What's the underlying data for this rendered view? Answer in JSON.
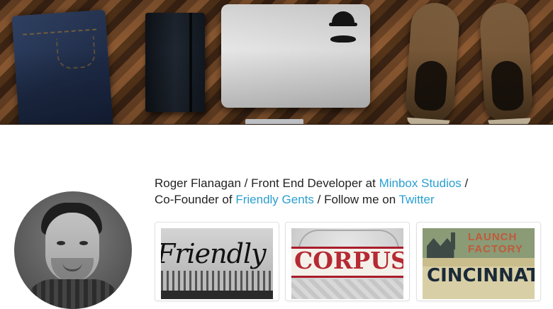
{
  "bio": {
    "name": "Roger Flanagan",
    "sep1": " / ",
    "role": "Front End Developer at ",
    "company_link": "Minbox Studios",
    "sep2": " /",
    "cofounder": "Co-Founder of ",
    "gents_link": "Friendly Gents",
    "sep3": " / ",
    "follow": "Follow me on ",
    "twitter_link": "Twitter"
  },
  "portfolio": [
    {
      "text": "Friendly Ge"
    },
    {
      "text": "CORPUS"
    },
    {
      "text_top": "LAUNCH\nFACTORY",
      "text_bottom": "CINCINNATI'S"
    }
  ],
  "colors": {
    "link": "#2a9fd0",
    "text": "#222222",
    "card_border": "#e2e2e2"
  },
  "icons": {
    "laptop_logo": "apple-logo-icon",
    "sticker_hat": "hat-sticker",
    "sticker_mustache": "mustache-sticker"
  }
}
